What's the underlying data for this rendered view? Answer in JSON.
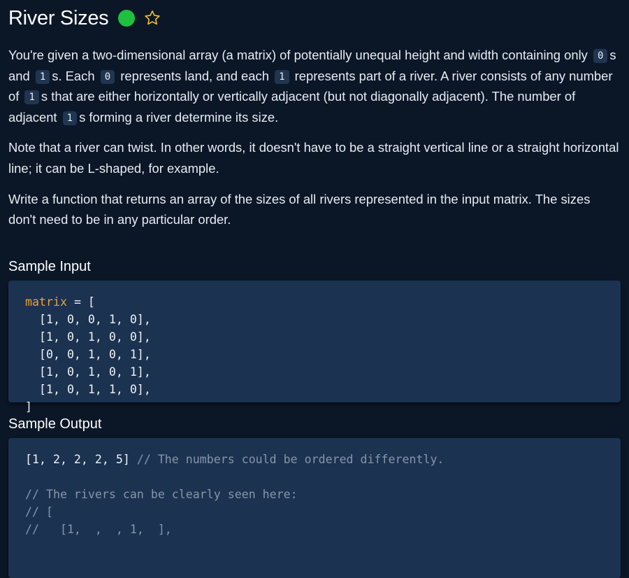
{
  "header": {
    "title": "River Sizes",
    "status_color": "#1fbf3f",
    "star_icon": "star-outline-icon"
  },
  "description": {
    "p1": {
      "t1": "You're given a two-dimensional array (a matrix) of potentially unequal height and width containing only",
      "c1": "0",
      "t2": "s and",
      "c2": "1",
      "t3": "s. Each",
      "c3": "0",
      "t4": "represents land, and each",
      "c4": "1",
      "t5": "represents part of a river. A river consists of any number of",
      "c5": "1",
      "t6": "s that are either horizontally or vertically adjacent (but not diagonally adjacent). The number of adjacent",
      "c6": "1",
      "t7": "s forming a river determine its size."
    },
    "p2": "Note that a river can twist. In other words, it doesn't have to be a straight vertical line or a straight horizontal line; it can be L-shaped, for example.",
    "p3": "Write a function that returns an array of the sizes of all rivers represented in the input matrix. The sizes don't need to be in any particular order."
  },
  "sample_input": {
    "heading": "Sample Input",
    "var_name": "matrix",
    "assign": " = [",
    "rows": [
      "  [1, 0, 0, 1, 0],",
      "  [1, 0, 1, 0, 0],",
      "  [0, 0, 1, 0, 1],",
      "  [1, 0, 1, 0, 1],",
      "  [1, 0, 1, 1, 0],"
    ],
    "close": "]"
  },
  "sample_output": {
    "heading": "Sample Output",
    "result": "[1, 2, 2, 2, 5]",
    "result_comment": " // The numbers could be ordered differently.",
    "comment_lines": [
      "// The rivers can be clearly seen here:",
      "// [",
      "//   [1,  ,  , 1,  ],"
    ]
  }
}
